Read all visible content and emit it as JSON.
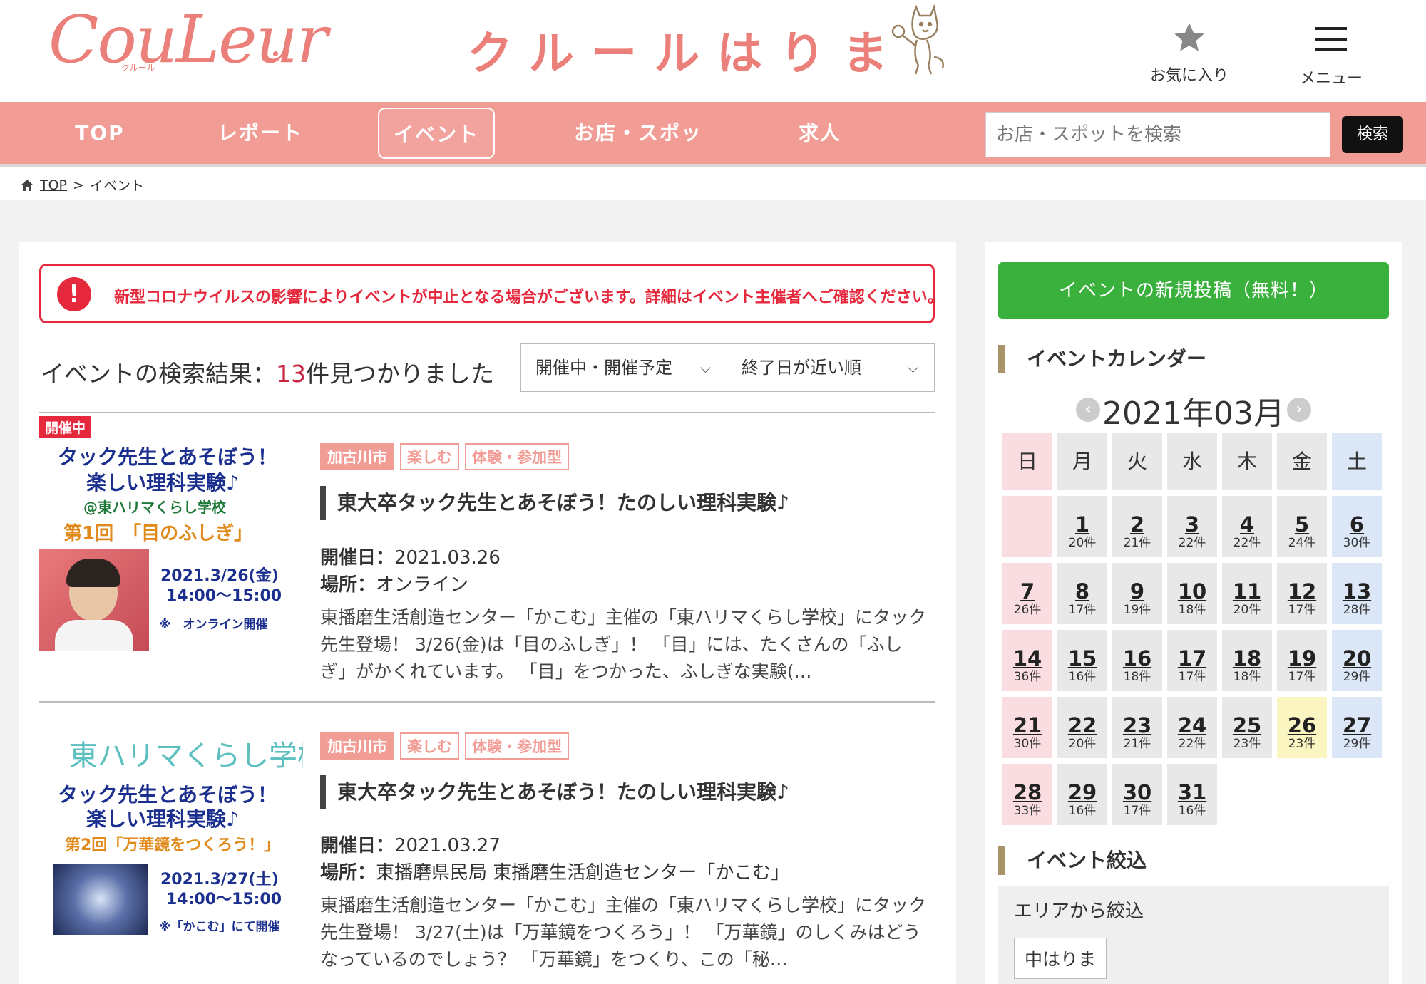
{
  "header": {
    "logo_text": "CouLeur",
    "logo_sub": "クルール",
    "site_title": "クルールはりま",
    "favorites_label": "お気に入り",
    "menu_label": "メニュー"
  },
  "nav": {
    "items": [
      "TOP",
      "レポート",
      "イベント",
      "お店・スポット",
      "求人"
    ],
    "active": "イベント",
    "search_placeholder": "お店・スポットを検索",
    "search_button": "検索"
  },
  "breadcrumb": {
    "home": "TOP",
    "separator": ">",
    "current": "イベント"
  },
  "alert": {
    "icon": "!",
    "text": "新型コロナウイルスの影響によりイベントが中止となる場合がございます。詳細はイベント主催者へご確認ください。"
  },
  "results": {
    "prefix": "イベントの検索結果：",
    "count": "13",
    "suffix": "件見つかりました",
    "filter_status": "開催中・開催予定",
    "sort_order": "終了日が近い順"
  },
  "events": [
    {
      "badge": "開催中",
      "tags": [
        "加古川市",
        "楽しむ",
        "体験・参加型"
      ],
      "title": "東大卒タック先生とあそぼう！たのしい理科実験♪",
      "date_label": "開催日：",
      "date": "2021.03.26",
      "place_label": "場所：",
      "place": "オンライン",
      "description": "東播磨生活創造センター「かこむ」主催の「東ハリマくらし学校」にタック先生登場！ 3/26(金)は「目のふしぎ」！ 「目」には、たくさんの「ふしぎ」がかくれています。 「目」をつかった、ふしぎな実験(…",
      "thumb": {
        "line1": "タック先生とあそぼう！",
        "line2": "楽しい理科実験♪",
        "line3": "@東ハリマくらし学校",
        "line4": "第1回　「目のふしぎ」",
        "line5": "2021.3/26(金)",
        "line6": "14:00〜15:00",
        "line7": "※　オンライン開催"
      }
    },
    {
      "badge": "",
      "tags": [
        "加古川市",
        "楽しむ",
        "体験・参加型"
      ],
      "title": "東大卒タック先生とあそぼう！たのしい理科実験♪",
      "date_label": "開催日：",
      "date": "2021.03.27",
      "place_label": "場所：",
      "place": "東播磨県民局 東播磨生活創造センター「かこむ」",
      "description": "東播磨生活創造センター「かこむ」主催の「東ハリマくらし学校」にタック先生登場！ 3/27(土)は「万華鏡をつくろう」！ 「万華鏡」のしくみはどうなっているのでしょう？ 「万華鏡」をつくり、この「秘…",
      "thumb": {
        "line0": "東ハリマくらし学校",
        "line1": "タック先生とあそぼう！",
        "line2": "楽しい理科実験♪",
        "line4": "第2回「万華鏡をつくろう！」",
        "line5": "2021.3/27(土)",
        "line6": "14:00〜15:00",
        "line7": "※「かこむ」にて開催"
      }
    }
  ],
  "sidebar": {
    "post_button": "イベントの新規投稿（無料！）",
    "calendar_heading": "イベントカレンダー",
    "calendar_title": "2021年03月",
    "weekdays": [
      "日",
      "月",
      "火",
      "水",
      "木",
      "金",
      "土"
    ],
    "days": [
      {
        "d": "",
        "c": ""
      },
      {
        "d": "1",
        "c": "20件"
      },
      {
        "d": "2",
        "c": "21件"
      },
      {
        "d": "3",
        "c": "22件"
      },
      {
        "d": "4",
        "c": "22件"
      },
      {
        "d": "5",
        "c": "24件"
      },
      {
        "d": "6",
        "c": "30件"
      },
      {
        "d": "7",
        "c": "26件"
      },
      {
        "d": "8",
        "c": "17件"
      },
      {
        "d": "9",
        "c": "19件"
      },
      {
        "d": "10",
        "c": "18件"
      },
      {
        "d": "11",
        "c": "20件"
      },
      {
        "d": "12",
        "c": "17件"
      },
      {
        "d": "13",
        "c": "28件"
      },
      {
        "d": "14",
        "c": "36件"
      },
      {
        "d": "15",
        "c": "16件"
      },
      {
        "d": "16",
        "c": "18件"
      },
      {
        "d": "17",
        "c": "17件"
      },
      {
        "d": "18",
        "c": "18件"
      },
      {
        "d": "19",
        "c": "17件"
      },
      {
        "d": "20",
        "c": "29件"
      },
      {
        "d": "21",
        "c": "30件"
      },
      {
        "d": "22",
        "c": "20件"
      },
      {
        "d": "23",
        "c": "21件"
      },
      {
        "d": "24",
        "c": "22件"
      },
      {
        "d": "25",
        "c": "23件"
      },
      {
        "d": "26",
        "c": "23件"
      },
      {
        "d": "27",
        "c": "29件"
      },
      {
        "d": "28",
        "c": "33件"
      },
      {
        "d": "29",
        "c": "16件"
      },
      {
        "d": "30",
        "c": "17件"
      },
      {
        "d": "31",
        "c": "16件"
      }
    ],
    "today": "26",
    "filter_heading": "イベント絞込",
    "filter_area_label": "エリアから絞込",
    "filter_area_chip": "中はりま"
  },
  "colors": {
    "brand": "#f29c96",
    "logo": "#ea8079",
    "alert": "#e5283c",
    "post_button": "#3bb13d"
  }
}
